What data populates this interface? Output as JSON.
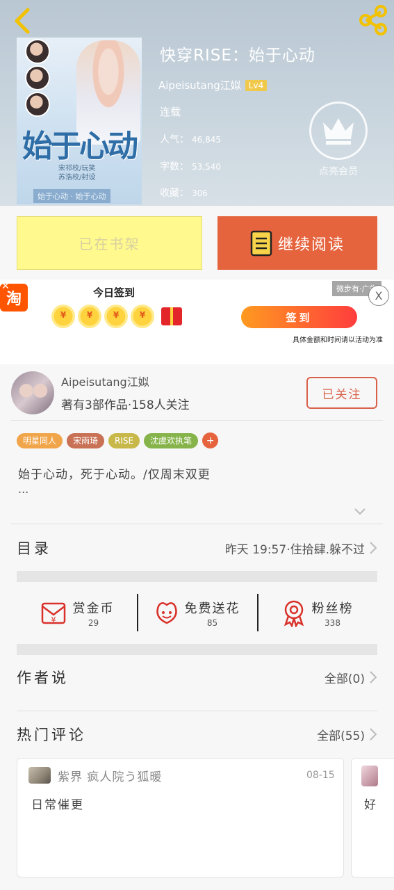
{
  "book": {
    "title": "快穿RISE：始于心动",
    "author": "Aipeisutang江姒",
    "level": "Lv4",
    "status": "连载",
    "popularity_label": "人气：",
    "popularity": "46,845",
    "words_label": "字数：",
    "words": "53,540",
    "favorites_label": "收藏：",
    "favorites": "306",
    "vip_label": "点亮会员"
  },
  "cover": {
    "title": "始于心动",
    "credits_line1": "宋祁校/玩笑",
    "credits_line2": "苏浩校/封设",
    "footer": "始于心动 · 始于心动"
  },
  "actions": {
    "shelf_label": "已在书架",
    "read_label": "继续阅读"
  },
  "ad": {
    "title": "今日签到",
    "coin_symbol": "¥",
    "signin_label": "签到",
    "note": "具体金额和时间请以活动为准",
    "ad_tag": "微步有·广告",
    "close_label": "X",
    "taobao": "淘"
  },
  "author_card": {
    "name": "Aipeisutang江姒",
    "meta": "著有3部作品·158人关注",
    "follow_label": "已关注"
  },
  "tags": [
    {
      "label": "明星同人",
      "color": "#f0a54a"
    },
    {
      "label": "宋雨琦",
      "color": "#c87155"
    },
    {
      "label": "RISE",
      "color": "#c8b84a"
    },
    {
      "label": "沈虞欢执笔",
      "color": "#86b44a"
    }
  ],
  "tag_add": "+",
  "description": "始于心动，死于心动。/仅周末双更",
  "description_more": "...",
  "catalog": {
    "label": "目录",
    "latest": "昨天 19:57·住拾肆.躲不过"
  },
  "rewards": [
    {
      "label": "赏金币",
      "count": "29",
      "icon": "red-envelope-icon"
    },
    {
      "label": "免费送花",
      "count": "85",
      "icon": "flower-icon"
    },
    {
      "label": "粉丝榜",
      "count": "338",
      "icon": "medal-icon"
    }
  ],
  "author_says": {
    "label": "作者说",
    "all": "全部(0)"
  },
  "hot_comments": {
    "label": "热门评论",
    "all": "全部(55)",
    "items": [
      {
        "user": "紫界 疯人院う狐暖",
        "date": "08-15",
        "text": "日常催更"
      },
      {
        "text": "好"
      }
    ]
  },
  "colors": {
    "accent": "#e6643d",
    "shelf_bg": "#fff98e",
    "follow": "#d9614a"
  }
}
